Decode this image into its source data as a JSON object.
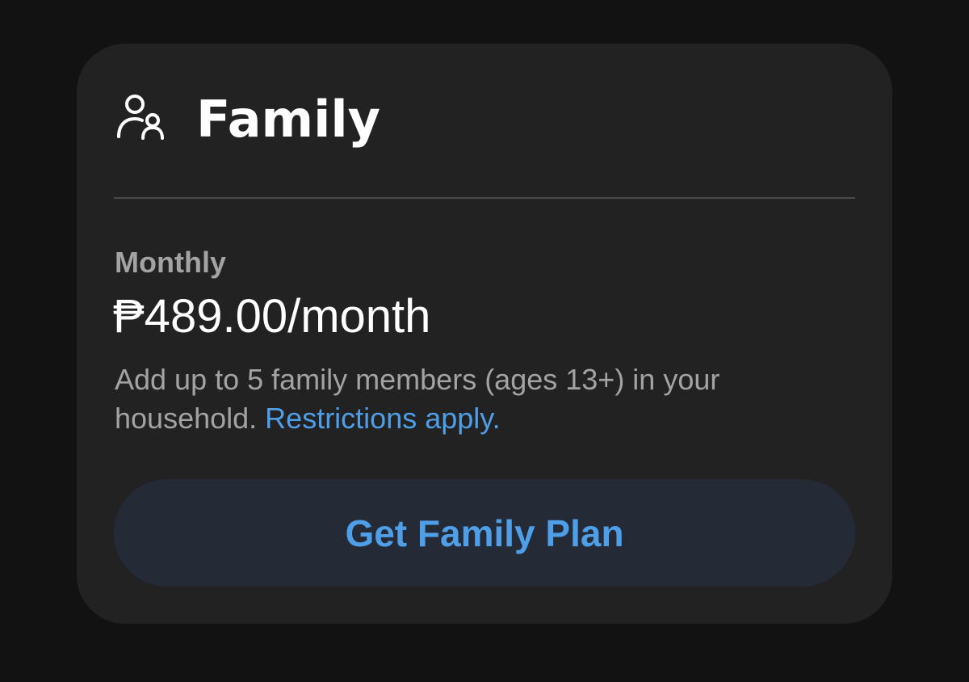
{
  "plan": {
    "icon": "family-icon",
    "title": "Family",
    "billing_period": "Monthly",
    "price": "₱489.00/month",
    "description": "Add up to 5 family members (ages 13+) in your household.",
    "restrictions_link": "Restrictions apply.",
    "cta_label": "Get Family Plan"
  },
  "colors": {
    "background": "#121212",
    "card": "#222222",
    "accent": "#4f9ee8",
    "muted_text": "#a3a3a3",
    "button_bg": "#252a37"
  }
}
